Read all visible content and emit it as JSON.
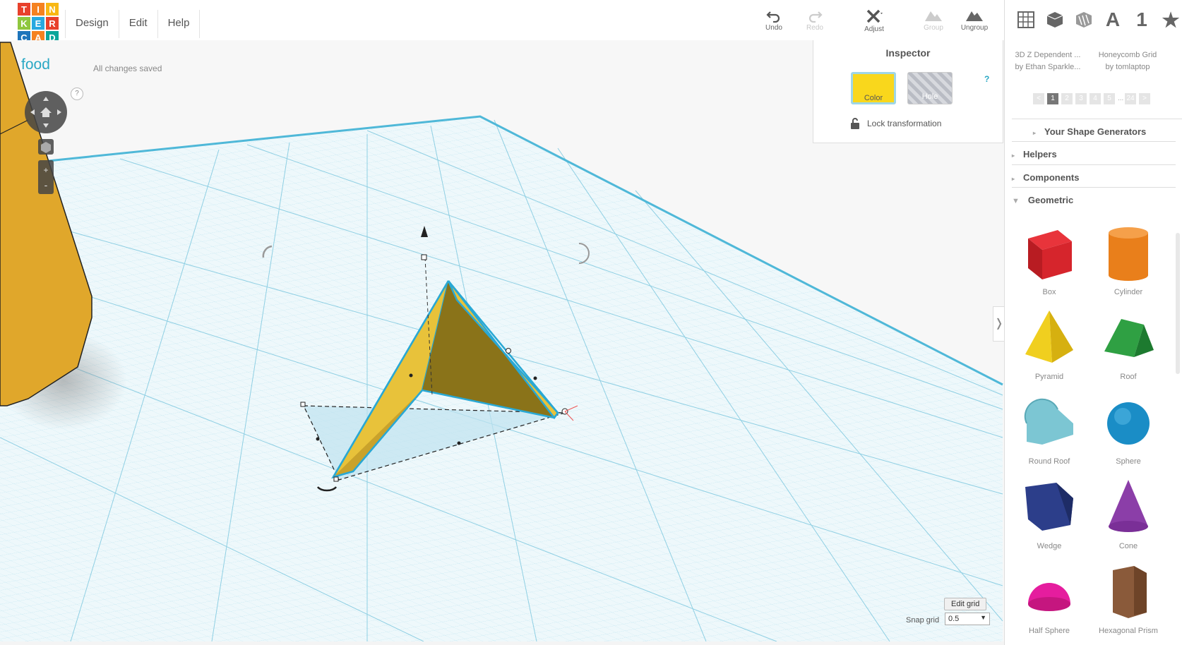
{
  "logo": {
    "letters": [
      "T",
      "I",
      "N",
      "K",
      "E",
      "R",
      "C",
      "A",
      "D"
    ],
    "colors": [
      "#e8412c",
      "#f58220",
      "#f8b814",
      "#8fc73e",
      "#27a9e0",
      "#e8412c",
      "#1e75bb",
      "#f58220",
      "#0aa69a"
    ]
  },
  "menu": {
    "items": [
      "Design",
      "Edit",
      "Help"
    ]
  },
  "project": {
    "name": "food",
    "status": "All changes saved",
    "help": "?"
  },
  "toolbar": {
    "undo": "Undo",
    "redo": "Redo",
    "adjust": "Adjust",
    "group": "Group",
    "ungroup": "Ungroup"
  },
  "sidebar_icons": {
    "text_icon": "A",
    "number_icon": "1",
    "star_icon": "★"
  },
  "inspector": {
    "title": "Inspector",
    "color_label": "Color",
    "hole_label": "Hole",
    "help": "?",
    "lock_label": "Lock transformation"
  },
  "featured": [
    {
      "title": "3D Z Dependent ...",
      "author": "by Ethan Sparkle..."
    },
    {
      "title": "Honeycomb Grid",
      "author": "by tomlaptop"
    }
  ],
  "pager": {
    "prev": "<",
    "pages": [
      "1",
      "2",
      "3",
      "4",
      "5"
    ],
    "ellipsis": "...",
    "last": "24",
    "next": ">",
    "current": "1"
  },
  "sections": [
    "Your Shape Generators",
    "Helpers",
    "Components",
    "Geometric"
  ],
  "shapes": [
    "Box",
    "Cylinder",
    "Pyramid",
    "Roof",
    "Round Roof",
    "Sphere",
    "Wedge",
    "Cone",
    "Half Sphere",
    "Hexagonal Prism"
  ],
  "grid": {
    "edit_label": "Edit grid",
    "snap_label": "Snap grid",
    "snap_value": "0.5"
  },
  "colors": {
    "accent": "#2aa8c4",
    "object": "#e8b92a",
    "grid_line": "#9fd4e6",
    "selected": "#f9d71c"
  }
}
